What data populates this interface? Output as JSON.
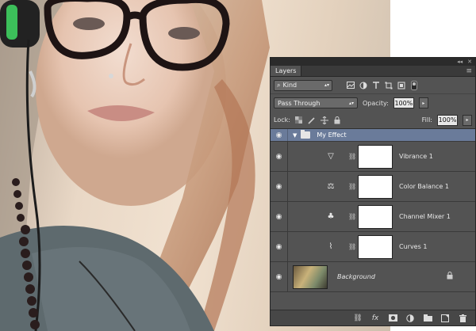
{
  "panel": {
    "collapse_glyph": "◂◂",
    "close_glyph": "✕",
    "tab_label": "Layers",
    "menu_icon": "≡"
  },
  "filter": {
    "search_glyph": "⌕",
    "kind_label": "Kind",
    "arrow": "▴▾",
    "icons": [
      "image-filter-icon",
      "adjustment-filter-icon",
      "type-filter-icon",
      "shape-filter-icon",
      "smart-object-filter-icon",
      "filter-toggle-icon"
    ]
  },
  "blend": {
    "mode": "Pass Through",
    "arrow": "▴▾",
    "opacity_label": "Opacity:",
    "opacity_value": "100%",
    "dropdown_arrow": "▸"
  },
  "lock": {
    "lock_label": "Lock:",
    "fill_label": "Fill:",
    "fill_value": "100%",
    "dropdown_arrow": "▸",
    "icons": [
      "lock-transparent-icon",
      "lock-pixels-icon",
      "lock-position-icon",
      "lock-all-icon"
    ]
  },
  "layers": {
    "eye_glyph": "◉",
    "chain_glyph": "⛓",
    "group": {
      "twirl": "▼",
      "name": "My Effect"
    },
    "adjustments": [
      {
        "name": "Vibrance 1",
        "icon": "vibrance-icon",
        "glyph": "▽"
      },
      {
        "name": "Color Balance 1",
        "icon": "color-balance-icon",
        "glyph": "⚖"
      },
      {
        "name": "Channel Mixer 1",
        "icon": "channel-mixer-icon",
        "glyph": "♣"
      },
      {
        "name": "Curves 1",
        "icon": "curves-icon",
        "glyph": "⌇"
      }
    ],
    "background": {
      "name": "Background",
      "lock_glyph": "🔒"
    }
  },
  "bottom_bar": {
    "icons": [
      {
        "name": "link-layers-icon",
        "glyph": "⛓"
      },
      {
        "name": "fx-icon",
        "glyph": "fx"
      },
      {
        "name": "add-mask-icon",
        "glyph": "◙"
      },
      {
        "name": "new-adjustment-icon",
        "glyph": "◐"
      },
      {
        "name": "new-group-icon",
        "glyph": "▬"
      },
      {
        "name": "new-layer-icon",
        "glyph": "▣"
      },
      {
        "name": "delete-layer-icon",
        "glyph": "🗑"
      }
    ]
  }
}
